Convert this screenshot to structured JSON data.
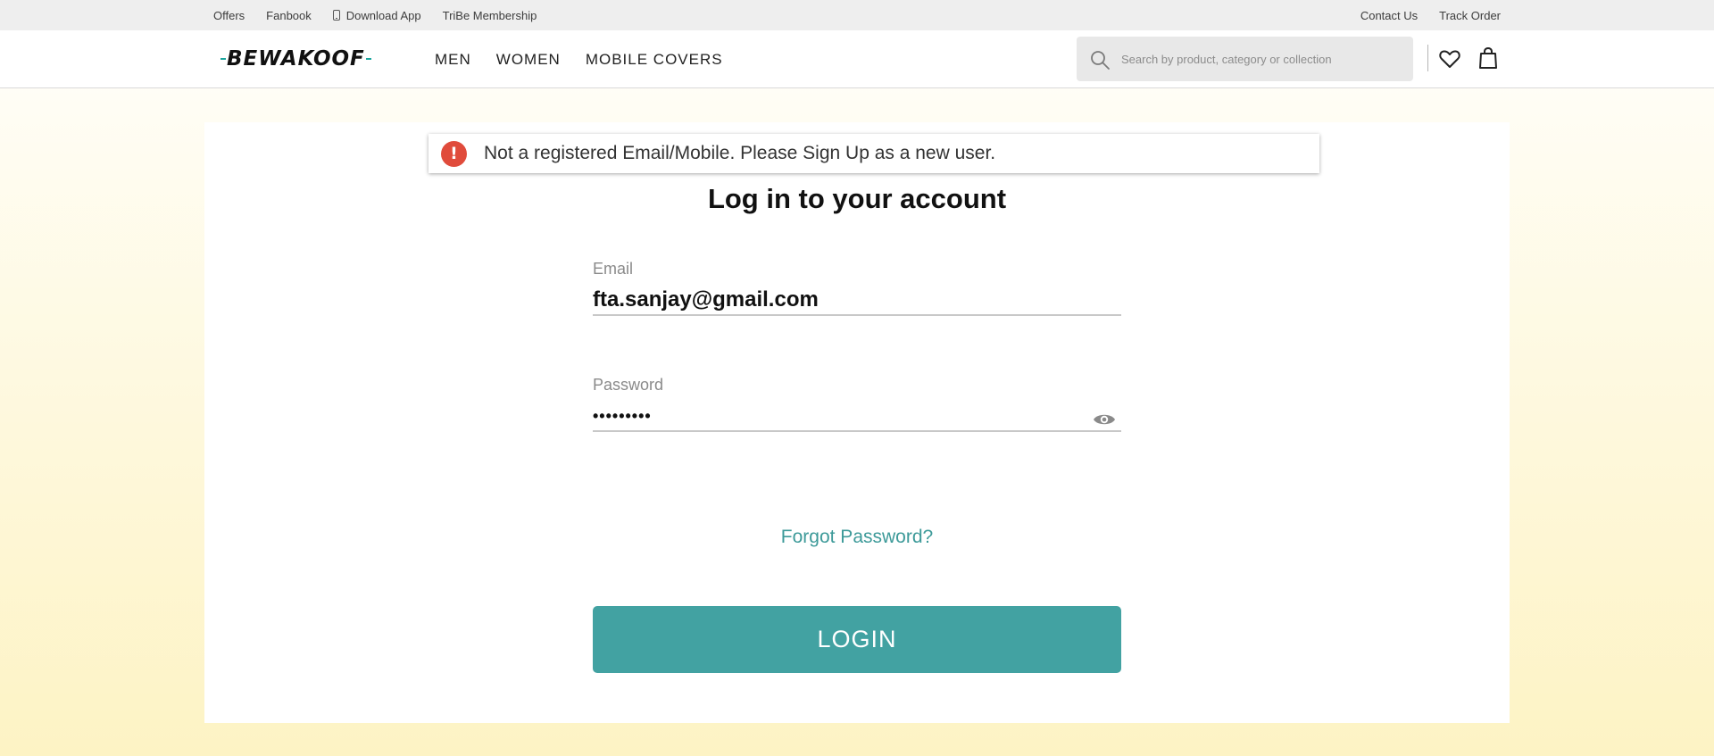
{
  "topbar": {
    "left_links": [
      "Offers",
      "Fanbook",
      "Download App",
      "TriBe Membership"
    ],
    "right_links": [
      "Contact Us",
      "Track Order"
    ]
  },
  "header": {
    "logo_text": "BEWAKOOF",
    "nav": [
      "MEN",
      "WOMEN",
      "MOBILE COVERS"
    ],
    "search_placeholder": "Search by product, category or collection"
  },
  "alert": {
    "message": "Not a registered Email/Mobile. Please Sign Up as a new user.",
    "icon": "error-exclamation-icon",
    "color": "#e04b3b"
  },
  "login": {
    "title": "Log in to your account",
    "email_label": "Email",
    "email_value": "fta.sanjay@gmail.com",
    "password_label": "Password",
    "password_value": "•••••••••",
    "forgot_label": "Forgot Password?",
    "submit_label": "LOGIN"
  },
  "colors": {
    "accent": "#42a2a2",
    "link": "#3d9a99",
    "error": "#e04b3b"
  }
}
